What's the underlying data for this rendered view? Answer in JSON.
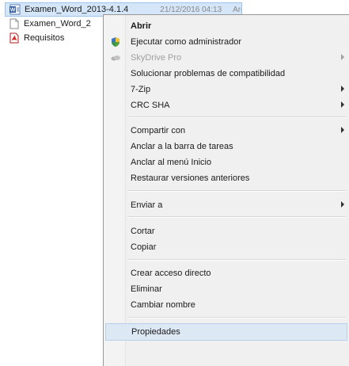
{
  "files": [
    {
      "name": "Examen_Word_2013-4.1.4",
      "date": "21/12/2016 04:13",
      "extra": "Arc",
      "icon": "word-doc-icon",
      "selected": true
    },
    {
      "name": "Examen_Word_2",
      "icon": "generic-doc-icon",
      "selected": false
    },
    {
      "name": "Requisitos",
      "icon": "pdf-doc-icon",
      "selected": false
    }
  ],
  "menu": {
    "items": [
      {
        "label": "Abrir",
        "bold": true
      },
      {
        "label": "Ejecutar como administrador",
        "icon": "uac-shield-icon"
      },
      {
        "label": "SkyDrive Pro",
        "disabled": true,
        "submenu": true,
        "icon": "skydrive-icon"
      },
      {
        "label": "Solucionar problemas de compatibilidad"
      },
      {
        "label": "7-Zip",
        "submenu": true
      },
      {
        "label": "CRC SHA",
        "submenu": true
      },
      {
        "label": "Compartir con",
        "submenu": true
      },
      {
        "label": "Anclar a la barra de tareas"
      },
      {
        "label": "Anclar al menú Inicio"
      },
      {
        "label": "Restaurar versiones anteriores"
      },
      {
        "label": "Enviar a",
        "submenu": true
      },
      {
        "label": "Cortar"
      },
      {
        "label": "Copiar"
      },
      {
        "label": "Crear acceso directo"
      },
      {
        "label": "Eliminar"
      },
      {
        "label": "Cambiar nombre"
      },
      {
        "label": "Propiedades",
        "highlight": true
      }
    ]
  },
  "colors": {
    "selection": "#d4e6f7",
    "menu_background": "#f0f0f0",
    "hover": "#dde8f5"
  }
}
